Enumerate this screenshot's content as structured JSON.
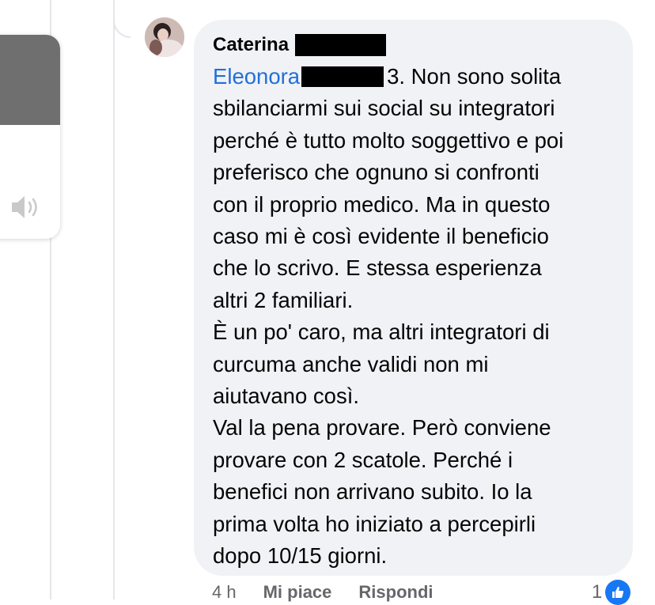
{
  "volume_overlay": {
    "icon": "speaker-icon",
    "level": 0.44,
    "fill_color": "#6f6f6f"
  },
  "comment": {
    "author": "Caterina",
    "mention": "Eleonora",
    "first_line_rest": "3. Non sono solita",
    "lines": [
      "sbilanciarmi sui social su integratori",
      "perché è tutto molto soggettivo e poi",
      "preferisco che ognuno si confronti",
      "con il proprio medico. Ma in questo",
      "caso mi è così evidente il beneficio",
      "che lo scrivo. E stessa esperienza",
      "altri 2 familiari.",
      "È un po' caro, ma altri integratori di",
      "curcuma anche validi non mi",
      "aiutavano così.",
      "Val la pena provare. Però conviene",
      "provare con 2 scatole. Perché i",
      "benefici non arrivano subito. Io la",
      "prima volta ho iniziato a percepirli",
      "dopo 10/15 giorni."
    ],
    "bubble_color": "#f0f2f5",
    "mention_color": "#216fdb"
  },
  "actions": {
    "time": "4 h",
    "like_label": "Mi piace",
    "reply_label": "Rispondi",
    "reaction_count": "1",
    "reaction_icon": "thumbs-up-icon",
    "reaction_color": "#1877f2"
  }
}
